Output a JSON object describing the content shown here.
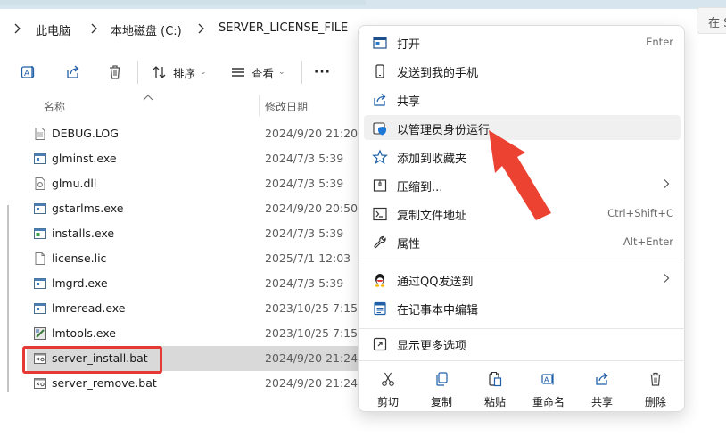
{
  "breadcrumb": {
    "items": [
      "此电脑",
      "本地磁盘 (C:)",
      "SERVER_LICENSE_FILE"
    ],
    "search_placeholder": "在 S"
  },
  "toolbar": {
    "sort_label": "排序",
    "view_label": "查看",
    "more_label": "···"
  },
  "columns": {
    "name": "名称",
    "modified": "修改日期"
  },
  "files": [
    {
      "name": "DEBUG.LOG",
      "modified": "2024/9/20 21:20",
      "icon": "log-file-icon"
    },
    {
      "name": "glminst.exe",
      "modified": "2024/7/3 5:39",
      "icon": "exe-file-icon"
    },
    {
      "name": "glmu.dll",
      "modified": "2024/7/3 5:39",
      "icon": "dll-file-icon"
    },
    {
      "name": "gstarlms.exe",
      "modified": "2024/9/20 20:50",
      "icon": "exe-file-icon"
    },
    {
      "name": "installs.exe",
      "modified": "2024/7/3 5:39",
      "icon": "installer-exe-icon"
    },
    {
      "name": "license.lic",
      "modified": "2025/7/1 12:03",
      "icon": "blank-file-icon"
    },
    {
      "name": "lmgrd.exe",
      "modified": "2024/7/3 5:39",
      "icon": "exe-file-icon"
    },
    {
      "name": "lmreread.exe",
      "modified": "2023/10/25 7:15",
      "icon": "exe-file-icon"
    },
    {
      "name": "lmtools.exe",
      "modified": "2023/10/25 7:15",
      "icon": "tools-exe-icon"
    },
    {
      "name": "server_install.bat",
      "modified": "2024/9/20 21:24",
      "icon": "batch-file-icon",
      "selected": true
    },
    {
      "name": "server_remove.bat",
      "modified": "2024/9/20 21:24",
      "icon": "batch-file-icon"
    }
  ],
  "context_menu": {
    "items": [
      {
        "label": "打开",
        "shortcut": "Enter",
        "icon": "open-icon"
      },
      {
        "label": "发送到我的手机",
        "shortcut": "",
        "icon": "phone-icon"
      },
      {
        "label": "共享",
        "shortcut": "",
        "icon": "share-icon"
      },
      {
        "label": "以管理员身份运行",
        "shortcut": "",
        "icon": "admin-shield-icon",
        "highlighted": true
      },
      {
        "label": "添加到收藏夹",
        "shortcut": "",
        "icon": "star-icon"
      },
      {
        "label": "压缩到...",
        "shortcut": "",
        "icon": "archive-icon",
        "submenu": true
      },
      {
        "label": "复制文件地址",
        "shortcut": "Ctrl+Shift+C",
        "icon": "copy-path-icon"
      },
      {
        "label": "属性",
        "shortcut": "Alt+Enter",
        "icon": "wrench-icon"
      },
      {
        "label": "通过QQ发送到",
        "shortcut": "",
        "icon": "qq-penguin-icon",
        "submenu": true
      },
      {
        "label": "在记事本中编辑",
        "shortcut": "",
        "icon": "notepad-icon"
      },
      {
        "label": "显示更多选项",
        "shortcut": "",
        "icon": "more-options-icon"
      }
    ],
    "quick_actions": [
      {
        "label": "剪切",
        "icon": "scissors-icon"
      },
      {
        "label": "复制",
        "icon": "copy-icon"
      },
      {
        "label": "粘贴",
        "icon": "paste-icon"
      },
      {
        "label": "重命名",
        "icon": "rename-icon"
      },
      {
        "label": "共享",
        "icon": "share-icon"
      },
      {
        "label": "删除",
        "icon": "trash-icon"
      }
    ]
  },
  "colors": {
    "accent": "#0067c0",
    "annotation_red": "#e53935",
    "selected_row": "#d9d9d9",
    "menu_hover": "#f0f0f0"
  }
}
